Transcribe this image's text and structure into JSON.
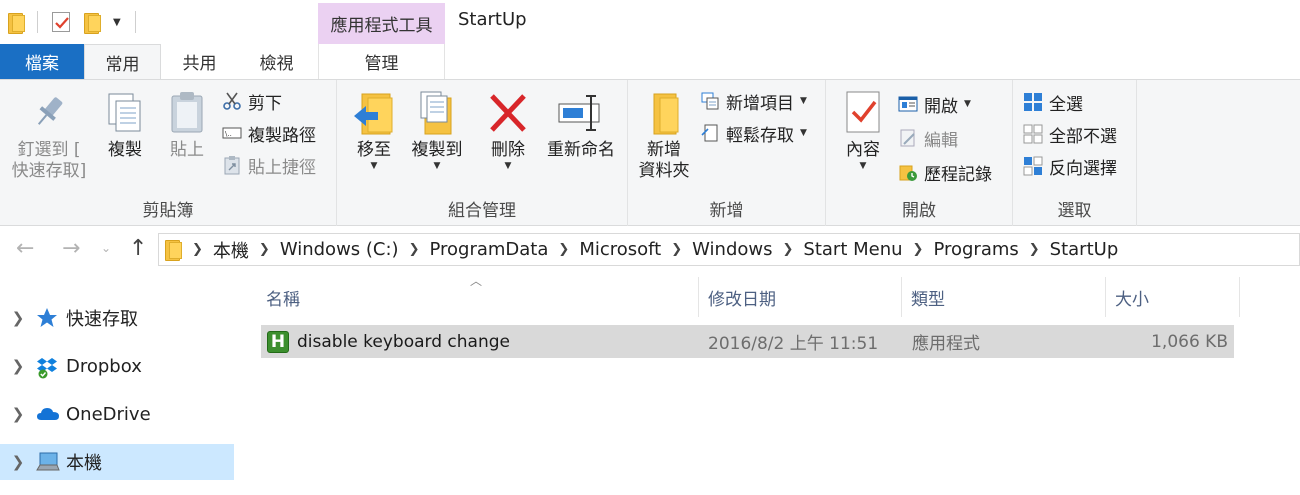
{
  "window": {
    "title": "StartUp",
    "context_tab_header": "應用程式工具"
  },
  "tabs": {
    "file": "檔案",
    "home": "常用",
    "share": "共用",
    "view": "檢視",
    "manage": "管理"
  },
  "ribbon": {
    "clipboard": {
      "label": "剪貼簿",
      "pin_line1": "釘選到 [",
      "pin_line2": "快速存取]",
      "copy": "複製",
      "paste": "貼上",
      "cut": "剪下",
      "copy_path": "複製路徑",
      "paste_shortcut": "貼上捷徑"
    },
    "organize": {
      "label": "組合管理",
      "move_to": "移至",
      "copy_to": "複製到",
      "delete": "刪除",
      "rename": "重新命名"
    },
    "new": {
      "label": "新增",
      "new_folder_line1": "新增",
      "new_folder_line2": "資料夾",
      "new_item": "新增項目",
      "easy_access": "輕鬆存取"
    },
    "open": {
      "label": "開啟",
      "properties": "內容",
      "open": "開啟",
      "edit": "編輯",
      "history": "歷程記錄"
    },
    "select": {
      "label": "選取",
      "select_all": "全選",
      "select_none": "全部不選",
      "invert_selection": "反向選擇"
    }
  },
  "address": {
    "crumbs": [
      "本機",
      "Windows (C:)",
      "ProgramData",
      "Microsoft",
      "Windows",
      "Start Menu",
      "Programs",
      "StartUp"
    ]
  },
  "nav_pane": {
    "items": [
      {
        "label": "快速存取",
        "icon": "star-icon"
      },
      {
        "label": "Dropbox",
        "icon": "dropbox-icon"
      },
      {
        "label": "OneDrive",
        "icon": "cloud-icon"
      },
      {
        "label": "本機",
        "icon": "computer-icon",
        "selected": true
      }
    ]
  },
  "file_list": {
    "columns": [
      "名稱",
      "修改日期",
      "類型",
      "大小"
    ],
    "rows": [
      {
        "name": "disable keyboard change",
        "modified": "2016/8/2 上午 11:51",
        "type": "應用程式",
        "size": "1,066 KB",
        "icon": "autohotkey-icon"
      }
    ]
  },
  "colors": {
    "file_tab": "#1a6fc4",
    "context_tab": "#ebd1f2",
    "selection": "#cce8ff",
    "row_highlight": "#d9d9d9"
  }
}
